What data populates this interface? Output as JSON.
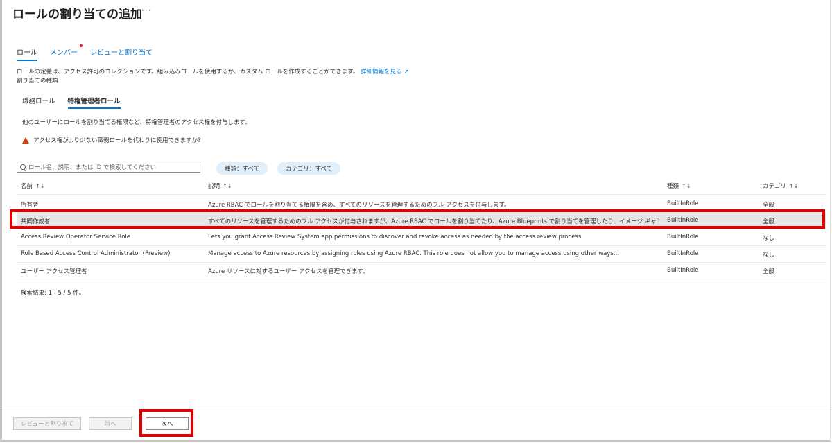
{
  "page": {
    "title": "ロールの割り当ての追加",
    "more": "···"
  },
  "tabs": [
    {
      "label": "ロール"
    },
    {
      "label": "メンバー"
    },
    {
      "label": "レビューと割り当て"
    }
  ],
  "description": {
    "text": "ロールの定義は、アクセス許可のコレクションです。組み込みロールを使用するか、カスタム ロールを作成することができます。",
    "link": "詳細情報を見る ↗",
    "assignment_type_label": "割り当ての種類"
  },
  "sub_tabs": [
    {
      "label": "職務ロール"
    },
    {
      "label": "特権管理者ロール"
    }
  ],
  "info_text": "他のユーザーにロールを割り当てる権限など、特権管理者のアクセス権を付与します。",
  "warning_text": "アクセス権がより少ない職務ロールを代わりに使用できますか?",
  "search": {
    "placeholder": "ロール名、説明、または ID で検索してください"
  },
  "filters": [
    {
      "label": "種類：すべて"
    },
    {
      "label": "カテゴリ：すべて"
    }
  ],
  "table": {
    "columns": [
      {
        "label": "名前",
        "sort": "↑↓"
      },
      {
        "label": "説明",
        "sort": "↑↓"
      },
      {
        "label": "種類",
        "sort": "↑↓"
      },
      {
        "label": "カテゴリ",
        "sort": "↑↓"
      }
    ],
    "rows": [
      {
        "name": "所有者",
        "description": "Azure RBAC でロールを割り当てる権限を含め、すべてのリソースを管理するためのフル アクセスを付与します。",
        "type": "BuiltInRole",
        "category": "全般"
      },
      {
        "name": "共同作成者",
        "description": "すべてのリソースを管理するためのフル アクセスが付与されますが、Azure RBAC でロールを割り当てたり、Azure Blueprints で割り当てを管理したり、イメージ ギャラリーを…",
        "type": "BuiltInRole",
        "category": "全般"
      },
      {
        "name": "Access Review Operator Service Role",
        "description": "Lets you grant Access Review System app permissions to discover and revoke access as needed by the access review process.",
        "type": "BuiltInRole",
        "category": "なし"
      },
      {
        "name": "Role Based Access Control Administrator (Preview)",
        "description": "Manage access to Azure resources by assigning roles using Azure RBAC. This role does not allow you to manage access using other ways…",
        "type": "BuiltInRole",
        "category": "なし"
      },
      {
        "name": "ユーザー アクセス管理者",
        "description": "Azure リソースに対するユーザー アクセスを管理できます。",
        "type": "BuiltInRole",
        "category": "全般"
      }
    ]
  },
  "results_text": "検索結果: 1 - 5 / 5 件。",
  "footer": {
    "review_label": "レビューと割り当て",
    "prev_label": "前へ",
    "next_label": "次へ"
  },
  "colors": {
    "accent": "#0078d4",
    "highlight": "#e00000",
    "warning": "#d83b01"
  }
}
